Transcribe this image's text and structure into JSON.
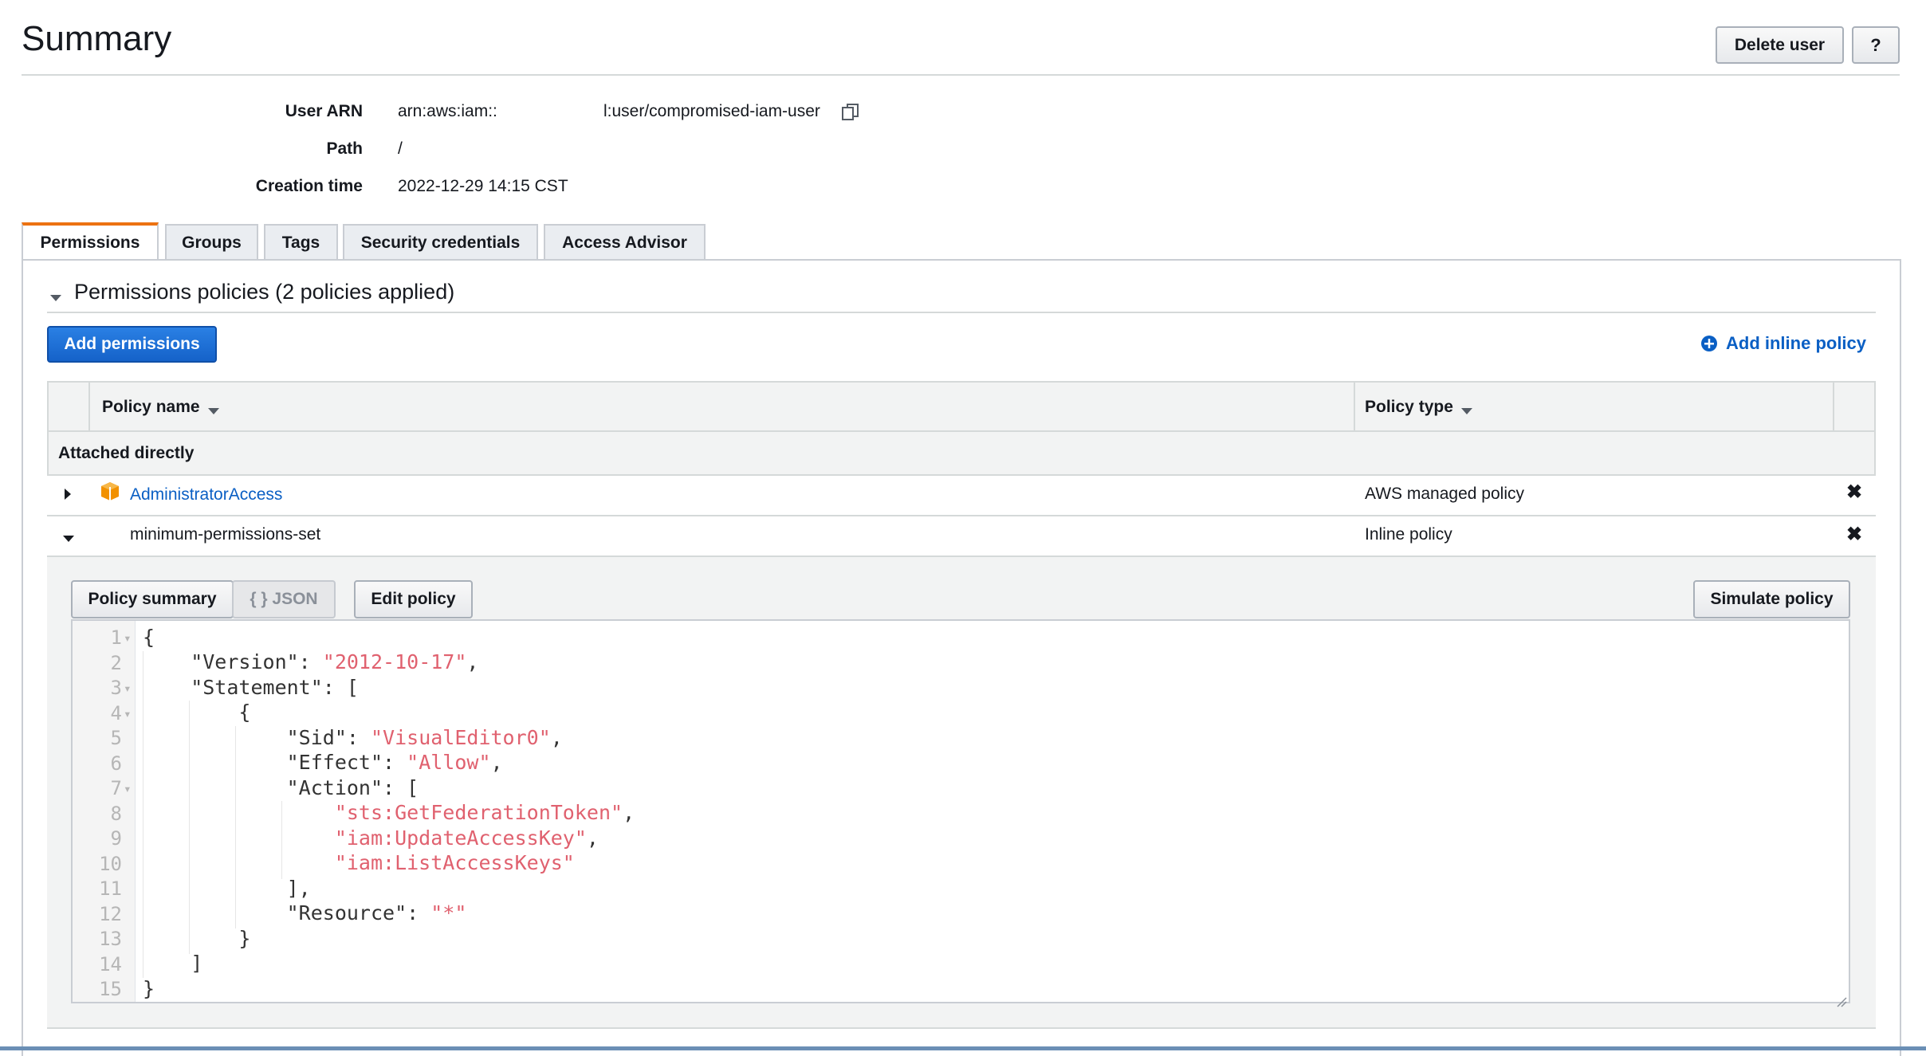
{
  "header": {
    "title": "Summary",
    "delete_user_label": "Delete user",
    "help_label": "?"
  },
  "summary": {
    "user_arn_label": "User ARN",
    "user_arn_value_prefix": "arn:aws:iam::",
    "user_arn_value_suffix": "l:user/compromised-iam-user",
    "path_label": "Path",
    "path_value": "/",
    "creation_time_label": "Creation time",
    "creation_time_value": "2022-12-29 14:15 CST"
  },
  "tabs": [
    {
      "label": "Permissions",
      "active": true
    },
    {
      "label": "Groups"
    },
    {
      "label": "Tags"
    },
    {
      "label": "Security credentials"
    },
    {
      "label": "Access Advisor"
    }
  ],
  "permissions": {
    "section_title": "Permissions policies (2 policies applied)",
    "add_permissions_label": "Add permissions",
    "add_inline_policy_label": "Add inline policy",
    "columns": {
      "policy_name": "Policy name",
      "policy_type": "Policy type"
    },
    "group_label": "Attached directly",
    "rows": [
      {
        "name": "AdministratorAccess",
        "type": "AWS managed policy",
        "remove": "✖"
      },
      {
        "name": "minimum-permissions-set",
        "type": "Inline policy",
        "remove": "✖"
      }
    ]
  },
  "policy_editor": {
    "summary_label": "Policy summary",
    "json_label": "{ } JSON",
    "edit_label": "Edit policy",
    "simulate_label": "Simulate policy",
    "line_numbers": [
      "1",
      "2",
      "3",
      "4",
      "5",
      "6",
      "7",
      "8",
      "9",
      "10",
      "11",
      "12",
      "13",
      "14",
      "15"
    ],
    "code": {
      "l1": "{",
      "l2_key": "    \"Version\": ",
      "l2_val": "\"2012-10-17\"",
      "l2_end": ",",
      "l3": "    \"Statement\": [",
      "l4": "        {",
      "l5_key": "            \"Sid\": ",
      "l5_val": "\"VisualEditor0\"",
      "l5_end": ",",
      "l6_key": "            \"Effect\": ",
      "l6_val": "\"Allow\"",
      "l6_end": ",",
      "l7": "            \"Action\": [",
      "l8_val": "\"sts:GetFederationToken\"",
      "l8_end": ",",
      "l9_val": "\"iam:UpdateAccessKey\"",
      "l9_end": ",",
      "l10_val": "\"iam:ListAccessKeys\"",
      "l11": "            ],",
      "l12_key": "            \"Resource\": ",
      "l12_val": "\"*\"",
      "l13": "        }",
      "l14": "    ]",
      "l15": "}"
    }
  },
  "colors": {
    "accent_tab": "#ec7211",
    "primary_button": "#1f6fd6",
    "link": "#0a5fc4",
    "json_string": "#e0616f"
  },
  "icons": [
    "copy-icon",
    "aws-managed-policy-icon",
    "add-circle-icon",
    "close-icon",
    "caret-down-icon",
    "caret-right-icon"
  ]
}
